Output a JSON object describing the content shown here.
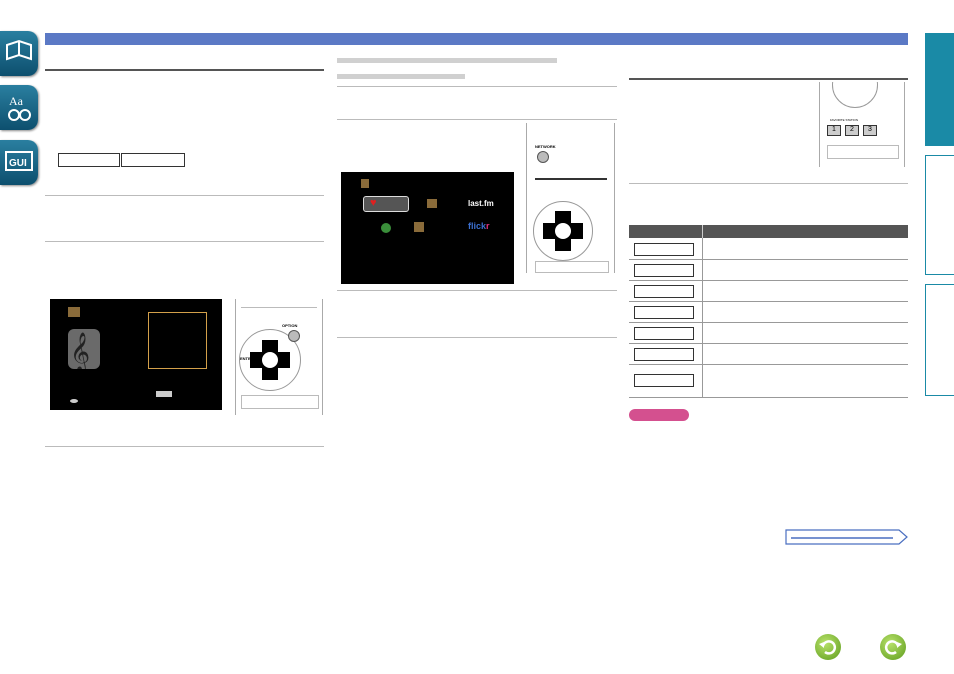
{
  "screen_left": {
    "lastfm": "last.fm",
    "flickr_pre": "flick",
    "flickr_post": "r"
  },
  "remote": {
    "network_label": "NETWORK",
    "option_label": "OPTION",
    "enter_label": "ENTER",
    "favorite_label": "FAVORITE STATION",
    "keys": [
      "1",
      "2",
      "3"
    ]
  },
  "colors": {
    "top_bar": "#5b79c5",
    "right_tab_active": "#1a8aa6",
    "note_badge": "#d4508f",
    "nav_green": "#7cbf2c"
  },
  "icons": [
    "book-icon",
    "dictionary-icon",
    "gui-icon",
    "back-icon",
    "forward-icon",
    "next-page-arrow-icon"
  ]
}
